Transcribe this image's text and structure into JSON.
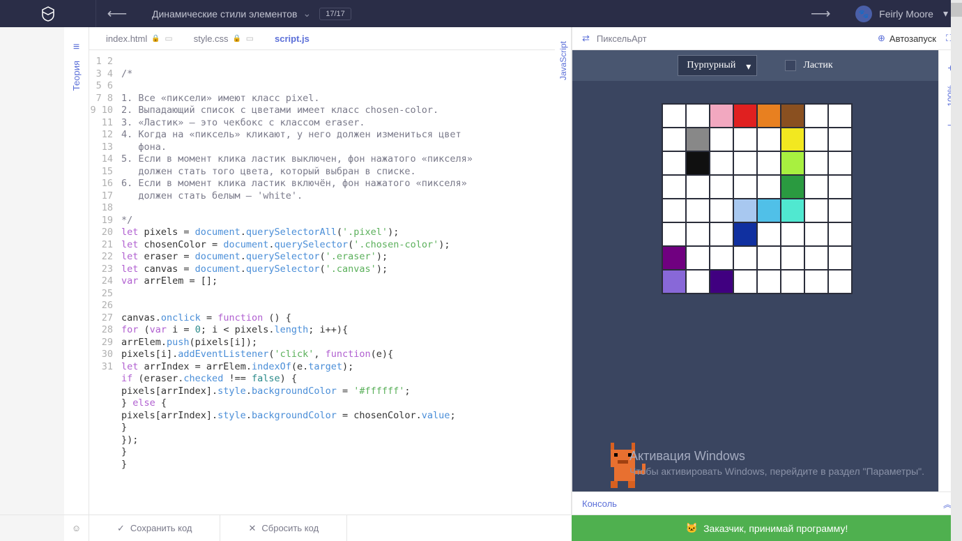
{
  "header": {
    "lesson_title": "Динамические стили элементов",
    "progress": "17/17",
    "user_name": "Feirly Moore"
  },
  "rails": {
    "theory": "Теория",
    "javascript": "JavaScript"
  },
  "tabs": [
    {
      "name": "index.html",
      "active": false,
      "locked": true
    },
    {
      "name": "style.css",
      "active": false,
      "locked": true
    },
    {
      "name": "script.js",
      "active": true,
      "locked": false
    }
  ],
  "code": {
    "lines": [
      "",
      "/*",
      "",
      "1. Все «пиксели» имеют класс pixel.",
      "2. Выпадающий список с цветами имеет класс chosen-color.",
      "3. «Ластик» — это чекбокс с классом eraser.",
      "4. Когда на «пиксель» кликают, у него должен измениться цвет фона.",
      "5. Если в момент клика ластик выключен, фон нажатого «пикселя» должен стать того цвета, который выбран в списке.",
      "6. Если в момент клика ластик включён, фон нажатого «пикселя» должен стать белым — 'white'.",
      "",
      "*/",
      "let pixels = document.querySelectorAll('.pixel');",
      "let chosenColor = document.querySelector('.chosen-color');",
      "let eraser = document.querySelector('.eraser');",
      "let canvas = document.querySelector('.canvas');",
      "var arrElem = [];",
      "",
      "",
      "canvas.onclick = function () {",
      "for (var i = 0; i < pixels.length; i++){",
      "arrElem.push(pixels[i]);",
      "pixels[i].addEventListener('click', function(e){",
      "let arrIndex = arrElem.indexOf(e.target);",
      "if (eraser.checked !== false) {",
      "pixels[arrIndex].style.backgroundColor = '#ffffff';",
      "} else {",
      "pixels[arrIndex].style.backgroundColor = chosenColor.value;",
      "}",
      "});",
      "}",
      "}"
    ],
    "line_numbers": [
      1,
      2,
      3,
      4,
      5,
      6,
      7,
      8,
      9,
      10,
      11,
      12,
      13,
      14,
      15,
      16,
      17,
      18,
      19,
      20,
      21,
      22,
      23,
      24,
      25,
      26,
      27,
      28,
      29,
      30,
      31
    ]
  },
  "preview": {
    "title": "ПиксельАрт",
    "autorun": "Автозапуск",
    "color_select": "Пурпурный",
    "eraser_label": "Ластик",
    "pixel_colors": {
      "2": "#f2a8c0",
      "3": "#e02020",
      "4": "#e88020",
      "5": "#8a5020",
      "9": "#888888",
      "13": "#f2e820",
      "17": "#101010",
      "21": "#a8f040",
      "29": "#2a9a40",
      "35": "#a8c8f0",
      "36": "#50c0e8",
      "37": "#50e8d0",
      "43": "#1030a0",
      "48": "#700080",
      "56": "#8868d8",
      "58": "#400080"
    },
    "watermark_title": "Активация Windows",
    "watermark_text": "Чтобы активировать Windows, перейдите в раздел \"Параметры\"."
  },
  "zoom": {
    "plus": "+",
    "percent": "100%",
    "minus": "–"
  },
  "console_label": "Консоль",
  "bottom": {
    "save": "Сохранить код",
    "reset": "Сбросить код",
    "submit": "Заказчик, принимай программу!"
  }
}
